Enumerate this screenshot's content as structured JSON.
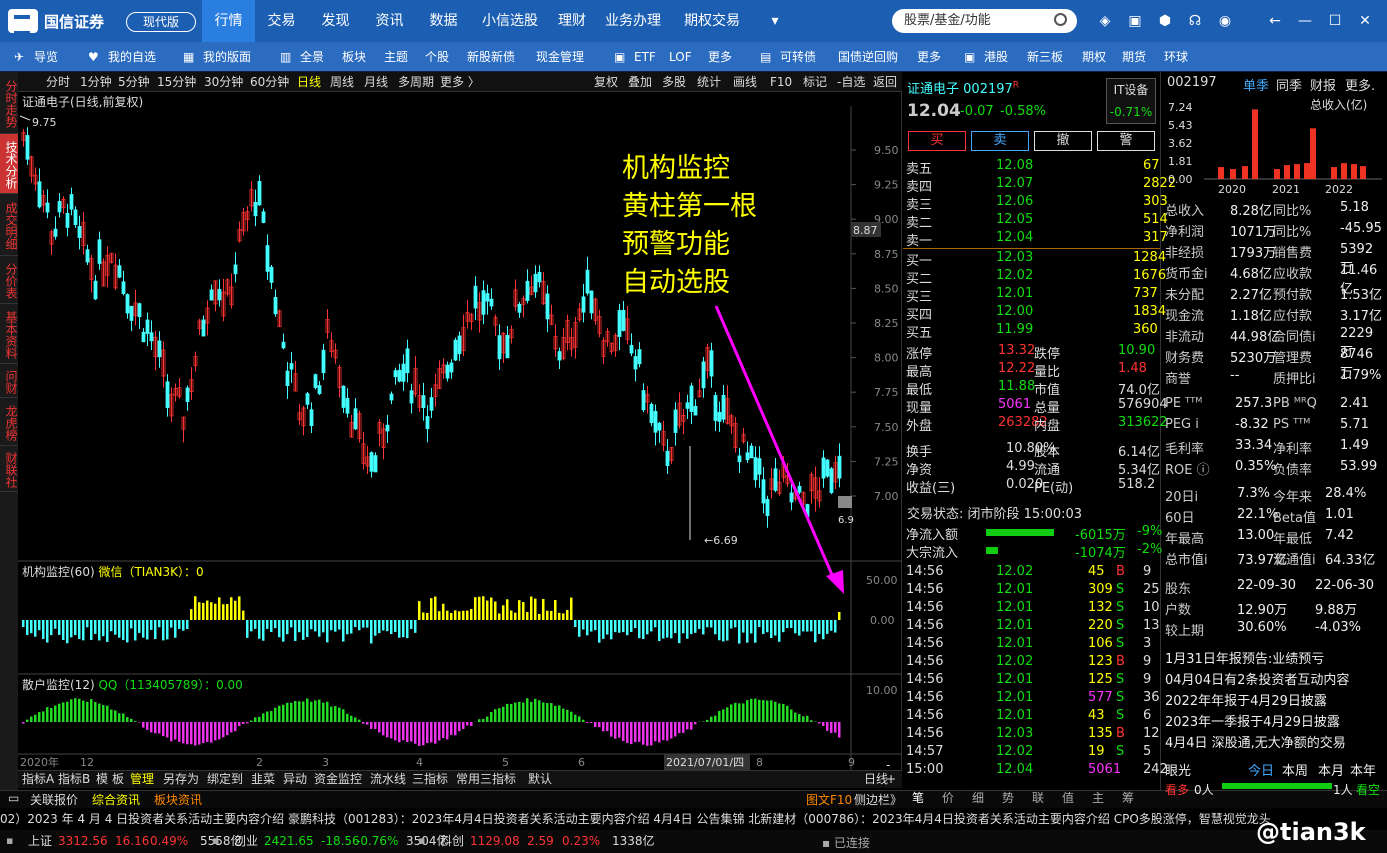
{
  "app": {
    "logo_text": "国信证券",
    "mode_button": "现代版"
  },
  "top_menu": [
    "行情",
    "交易",
    "发现",
    "资讯",
    "数据",
    "小信选股",
    "理财",
    "业务办理",
    "期权交易"
  ],
  "top_menu_active": "行情",
  "search": {
    "placeholder": "股票/基金/功能"
  },
  "nav": [
    "导览",
    "我的自选",
    "我的版面",
    "全景",
    "板块",
    "主题",
    "个股",
    "新股新债",
    "现金管理",
    "ETF",
    "LOF",
    "更多",
    "可转债",
    "国债逆回购",
    "更多",
    "港股",
    "新三板",
    "期权",
    "期货",
    "环球"
  ],
  "left_tabs": [
    "分时走势",
    "技术分析",
    "成交明细",
    "分价表",
    "基本资料",
    "问财",
    "龙虎榜",
    "财联社"
  ],
  "periods": [
    "分时",
    "1分钟",
    "5分钟",
    "15分钟",
    "30分钟",
    "60分钟",
    "日线",
    "周线",
    "月线",
    "多周期",
    "更多 〉"
  ],
  "period_tools": [
    "复权",
    "叠加",
    "多股",
    "统计",
    "画线",
    "F10",
    "标记",
    "-自选",
    "返回"
  ],
  "chart": {
    "title": "证通电子(日线,前复权)",
    "high_label": "9.75",
    "low_label": "6.69",
    "last_label": "6.9",
    "price_tag": "8.87",
    "y_ticks": [
      "9.50",
      "9.25",
      "9.00",
      "8.75",
      "8.50",
      "8.25",
      "8.00",
      "7.75",
      "7.50",
      "7.25",
      "7.00"
    ],
    "x_ticks": [
      "2020年",
      "12",
      "2",
      "3",
      "4",
      "5",
      "6",
      "8",
      "9"
    ],
    "date_cursor": "2021/07/01/四"
  },
  "overlay": [
    "机构监控",
    "黄柱第一根",
    "预警功能",
    "自动选股"
  ],
  "ind1": {
    "title": "机构监控(60)",
    "weixin": "微信（TIAN3K）：0",
    "ticks": [
      "50.00",
      "0.00"
    ]
  },
  "ind2": {
    "title": "散户监控(12)",
    "qq": "QQ（113405789）：0.00",
    "ticks": [
      "10.00"
    ]
  },
  "bottom_tabs": [
    "指标A",
    "指标B",
    "模",
    "板",
    "管理",
    "另存为",
    "绑定到",
    "韭菜",
    "异动",
    "资金监控",
    "流水线",
    "三指标",
    "常用三指标",
    "默认"
  ],
  "bottom_right": [
    "日线",
    "-",
    "+"
  ],
  "stock": {
    "name": "证通电子",
    "code": "002197",
    "flag": "R",
    "price": "12.04",
    "change": "-0.07",
    "pct": "-0.58%",
    "sector": "IT设备",
    "sector_pct": "-0.71%"
  },
  "trade_buttons": [
    "买",
    "卖",
    "撤",
    "警"
  ],
  "asks": [
    [
      "卖五",
      "12.08",
      "67"
    ],
    [
      "卖四",
      "12.07",
      "2822"
    ],
    [
      "卖三",
      "12.06",
      "303"
    ],
    [
      "卖二",
      "12.05",
      "514"
    ],
    [
      "卖一",
      "12.04",
      "317"
    ]
  ],
  "bids": [
    [
      "买一",
      "12.03",
      "1284"
    ],
    [
      "买二",
      "12.02",
      "1676"
    ],
    [
      "买三",
      "12.01",
      "737"
    ],
    [
      "买四",
      "12.00",
      "1834"
    ],
    [
      "买五",
      "11.99",
      "360"
    ]
  ],
  "quote": [
    [
      "涨停",
      "13.32",
      "跌停",
      "10.90"
    ],
    [
      "最高",
      "12.22",
      "量比",
      "1.48"
    ],
    [
      "最低",
      "11.88",
      "市值",
      "74.0亿"
    ],
    [
      "现量",
      "5061",
      "总量",
      "576904"
    ],
    [
      "外盘",
      "263282",
      "内盘",
      "313622"
    ]
  ],
  "quote2": [
    [
      "换手",
      "10.80%",
      "股本",
      "6.14亿"
    ],
    [
      "净资",
      "4.99",
      "流通",
      "5.34亿"
    ],
    [
      "收益(三)",
      "0.020",
      "PE(动)",
      "518.2"
    ]
  ],
  "status": "交易状态: 闭市阶段 15:00:03",
  "flows": [
    [
      "净流入额",
      "-6015万",
      "-9%"
    ],
    [
      "大宗流入",
      "-1074万",
      "-2%"
    ]
  ],
  "ticks": [
    [
      "14:56",
      "12.02",
      "45",
      "B",
      "9"
    ],
    [
      "14:56",
      "12.01",
      "309",
      "S",
      "25"
    ],
    [
      "14:56",
      "12.01",
      "132",
      "S",
      "10"
    ],
    [
      "14:56",
      "12.01",
      "220",
      "S",
      "13"
    ],
    [
      "14:56",
      "12.01",
      "106",
      "S",
      "3"
    ],
    [
      "14:56",
      "12.02",
      "123",
      "B",
      "9"
    ],
    [
      "14:56",
      "12.01",
      "125",
      "S",
      "9"
    ],
    [
      "14:56",
      "12.01",
      "577",
      "S",
      "36"
    ],
    [
      "14:56",
      "12.01",
      "43",
      "S",
      "6"
    ],
    [
      "14:56",
      "12.03",
      "135",
      "B",
      "12"
    ],
    [
      "14:57",
      "12.02",
      "19",
      "S",
      "5"
    ],
    [
      "15:00",
      "12.04",
      "5061",
      "",
      "242"
    ]
  ],
  "right_bottom_tabs": [
    "笔",
    "价",
    "细",
    "势",
    "联",
    "值",
    "主",
    "筹"
  ],
  "fin": {
    "code": "002197",
    "tabs": [
      "单季",
      "同季",
      "财报",
      "更多."
    ],
    "label": "总收入(亿)",
    "y_ticks": [
      "7.24",
      "5.43",
      "3.62",
      "1.81",
      "0.00"
    ],
    "years": [
      "2020",
      "2021",
      "2022"
    ],
    "bars": [
      1.2,
      1.0,
      1.3,
      7.0,
      1.0,
      1.4,
      1.5,
      1.6,
      5.1,
      1.2,
      1.6,
      1.5,
      1.3
    ],
    "rows": [
      [
        "总收入",
        "8.28亿",
        "同比%",
        "5.18"
      ],
      [
        "净利润",
        "1071万",
        "同比%",
        "-45.95"
      ],
      [
        "非经损",
        "1793万",
        "销售费",
        "5392万"
      ],
      [
        "货币金i",
        "4.68亿",
        "应收款",
        "11.46亿"
      ],
      [
        "未分配",
        "2.27亿",
        "预付款",
        "1.53亿"
      ],
      [
        "现金流",
        "1.18亿",
        "应付款",
        "3.17亿"
      ],
      [
        "非流动",
        "44.98亿",
        "合同债i",
        "2229万"
      ],
      [
        "财务费",
        "5230万",
        "管理费",
        "8746万"
      ],
      [
        "商誉",
        "--",
        "质押比i",
        "1.79%"
      ]
    ],
    "rows2": [
      [
        "PE ᵀᵀᴹ",
        "257.3",
        "PB ᴹᴿQ",
        "2.41"
      ],
      [
        "PEG i",
        "-8.32",
        "PS ᵀᵀᴹ",
        "5.71"
      ],
      [
        "毛利率",
        "33.34",
        "净利率",
        "1.49"
      ],
      [
        "ROE ⓘ",
        "0.35%",
        "负债率",
        "53.99"
      ]
    ],
    "rows3": [
      [
        "20日i",
        "7.3%",
        "今年来",
        "28.4%"
      ],
      [
        "60日",
        "22.1%",
        "Beta值",
        "1.01"
      ],
      [
        "年最高",
        "13.00",
        "年最低",
        "7.42"
      ],
      [
        "总市值i",
        "73.97亿",
        "流通值i",
        "64.33亿"
      ]
    ],
    "holders": [
      [
        "股东",
        "22-09-30",
        "22-06-30"
      ],
      [
        "户数",
        "12.90万",
        "9.88万"
      ],
      [
        "较上期",
        "30.60%",
        "-4.03%"
      ]
    ],
    "news": [
      "1月31日年报预告:业绩预亏",
      "04月04日有2条投资者互动内容",
      "2022年年报于4月29日披露",
      "2023年一季报于4月29日披露",
      "4月4日 深股通,无大净额的交易"
    ],
    "view_tabs": [
      "眼光",
      "今日",
      "本周",
      "本月",
      "本年"
    ],
    "view_counts": [
      "看多",
      "0人",
      "1人",
      "看空"
    ]
  },
  "newsbar": [
    "关联报价",
    "综合资讯",
    "板块资讯"
  ],
  "newsbar_right": "图文F10",
  "newsbar_right2": "侧边栏》",
  "ticker": "02）2023 年 4 月 4 日投资者关系活动主要内容介绍     豪鹏科技（001283）：2023年4月4日投资者关系活动主要内容介绍     4月4日 公告集锦     北新建材（000786）：2023年4月4日投资者关系活动主要内容介绍     CPO多股涨停，智慧视觉龙头",
  "indices": [
    [
      "上证",
      "3312.56",
      "16.16",
      "0.49%",
      "5558亿"
    ],
    [
      "创业",
      "2421.65",
      "-18.56",
      "-0.76%",
      "3504亿"
    ],
    [
      "科创",
      "1129.08",
      "2.59",
      "0.23%",
      "1338亿"
    ]
  ],
  "connection": "已连接",
  "watermark": "@tian3k"
}
